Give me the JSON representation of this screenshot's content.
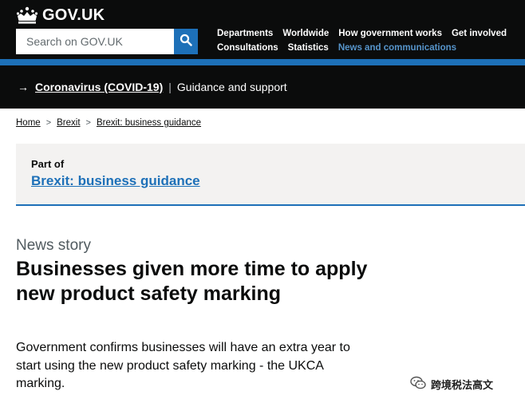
{
  "header": {
    "logo_text": "GOV.UK",
    "search_placeholder": "Search on GOV.UK",
    "nav_row1": [
      "Departments",
      "Worldwide",
      "How government works",
      "Get involved"
    ],
    "nav_row2": [
      "Consultations",
      "Statistics",
      "News and communications"
    ]
  },
  "covid_banner": {
    "arrow": "→",
    "link": "Coronavirus (COVID-19)",
    "separator": "|",
    "text": "Guidance and support"
  },
  "breadcrumb": {
    "items": [
      "Home",
      "Brexit",
      "Brexit: business guidance"
    ]
  },
  "part_of": {
    "label": "Part of",
    "link": "Brexit: business guidance"
  },
  "article": {
    "type": "News story",
    "title_line1": "Businesses given more time to apply",
    "title_line2": "new product safety marking",
    "summary_line1": "Government confirms businesses will have an extra year to",
    "summary_line2": "start using the new product safety marking - the UKCA",
    "summary_line3": "marking."
  },
  "watermark": {
    "text": "跨境税法高文"
  },
  "colors": {
    "header_bg": "#0b0c0c",
    "brand_blue": "#1d70b8",
    "panel_bg": "#f3f2f1",
    "secondary_text": "#505a5f"
  },
  "icons": [
    "crown-icon",
    "search-icon",
    "arrow-right-icon",
    "chevron-right-icon",
    "wechat-icon"
  ]
}
